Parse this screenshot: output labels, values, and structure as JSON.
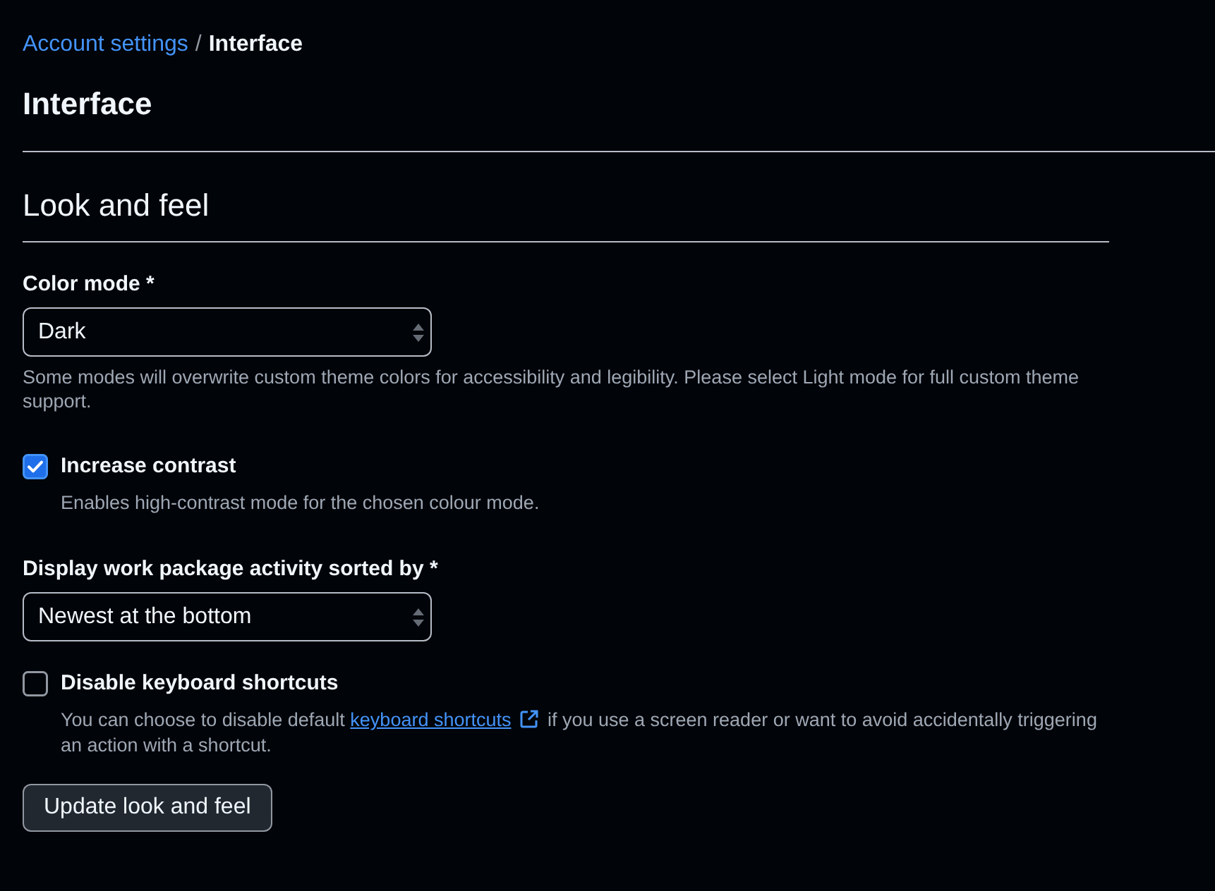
{
  "breadcrumb": {
    "items": [
      {
        "label": "Account settings",
        "kind": "link"
      },
      {
        "label": "Interface",
        "kind": "current"
      }
    ],
    "separator": "/"
  },
  "page_title": "Interface",
  "section": {
    "title": "Look and feel",
    "fields": [
      {
        "kind": "select",
        "label": "Color mode *",
        "value": "Dark",
        "help": [
          {
            "kind": "text",
            "text": "Some modes will overwrite custom theme colors for accessibility and legibility. Please select Light mode for full custom theme support."
          }
        ]
      },
      {
        "kind": "checkbox",
        "label": "Increase contrast",
        "checked": true,
        "help": [
          {
            "kind": "text",
            "text": "Enables high-contrast mode for the chosen colour mode."
          }
        ]
      },
      {
        "kind": "select",
        "label": "Display work package activity sorted by *",
        "value": "Newest at the bottom"
      },
      {
        "kind": "checkbox",
        "label": "Disable keyboard shortcuts",
        "checked": false,
        "help": [
          {
            "kind": "text",
            "text": "You can choose to disable default "
          },
          {
            "kind": "link",
            "text": "keyboard shortcuts"
          },
          {
            "kind": "text",
            "text": " if you use a screen reader or want to avoid accidentally triggering an action with a shortcut."
          }
        ]
      }
    ],
    "submit": "Update look and feel"
  }
}
